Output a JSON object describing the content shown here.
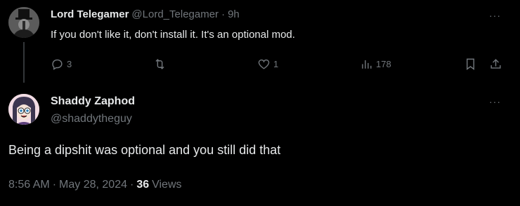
{
  "reply": {
    "display_name": "Lord Telegamer",
    "handle": "@Lord_Telegamer",
    "separator": "·",
    "time": "9h",
    "text": "If you don't like it, don't install it. It's an optional mod.",
    "more_label": "···",
    "actions": {
      "reply_count": "3",
      "retweet_count": "",
      "like_count": "1",
      "views_count": "178"
    }
  },
  "tweet": {
    "display_name": "Shaddy Zaphod",
    "handle": "@shaddytheguy",
    "more_label": "···",
    "text": "Being a dipshit was optional and you still did that",
    "time": "8:56 AM",
    "sep1": "·",
    "date": "May 28, 2024",
    "sep2": "·",
    "views_count": "36",
    "views_label": "Views"
  },
  "colors": {
    "background": "#000000",
    "primary_text": "#e7e9ea",
    "secondary_text": "#71767b",
    "thread_line": "#333639"
  },
  "icons": [
    "reply-icon",
    "retweet-icon",
    "like-icon",
    "views-icon",
    "bookmark-icon",
    "share-icon",
    "more-icon"
  ]
}
